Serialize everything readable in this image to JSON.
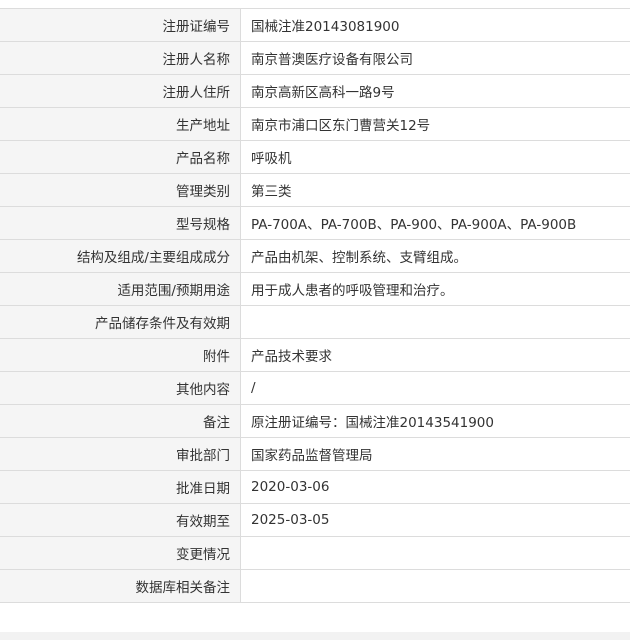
{
  "rows": [
    {
      "label": "注册证编号",
      "value": "国械注准20143081900"
    },
    {
      "label": "注册人名称",
      "value": "南京普澳医疗设备有限公司"
    },
    {
      "label": "注册人住所",
      "value": "南京高新区高科一路9号"
    },
    {
      "label": "生产地址",
      "value": "南京市浦口区东门曹营关12号"
    },
    {
      "label": "产品名称",
      "value": "呼吸机"
    },
    {
      "label": "管理类别",
      "value": "第三类"
    },
    {
      "label": "型号规格",
      "value": "PA-700A、PA-700B、PA-900、PA-900A、PA-900B"
    },
    {
      "label": "结构及组成/主要组成成分",
      "value": "产品由机架、控制系统、支臂组成。"
    },
    {
      "label": "适用范围/预期用途",
      "value": "用于成人患者的呼吸管理和治疗。"
    },
    {
      "label": "产品储存条件及有效期",
      "value": ""
    },
    {
      "label": "附件",
      "value": "产品技术要求"
    },
    {
      "label": "其他内容",
      "value": "/"
    },
    {
      "label": "备注",
      "value": "原注册证编号：国械注准20143541900"
    },
    {
      "label": "审批部门",
      "value": "国家药品监督管理局"
    },
    {
      "label": "批准日期",
      "value": "2020-03-06"
    },
    {
      "label": "有效期至",
      "value": "2025-03-05"
    },
    {
      "label": "变更情况",
      "value": ""
    },
    {
      "label": "数据库相关备注",
      "value": ""
    }
  ]
}
